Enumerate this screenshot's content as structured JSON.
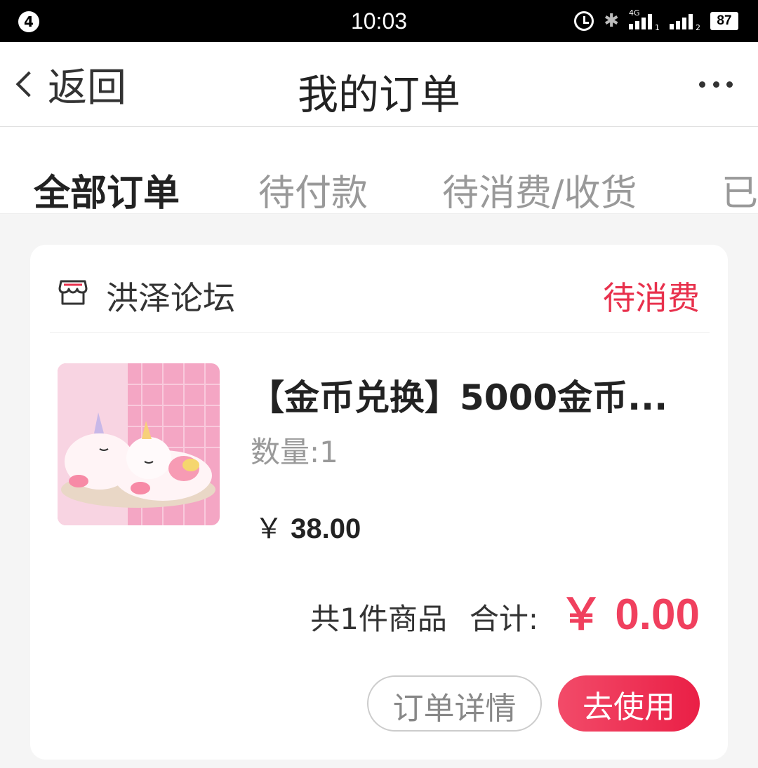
{
  "status_bar": {
    "notification_count": "4",
    "time": "10:03",
    "signal1_label": "4G",
    "signal1_sub": "1",
    "signal2_sub": "2",
    "battery": "87"
  },
  "nav": {
    "back_label": "返回",
    "title": "我的订单"
  },
  "tabs": [
    {
      "label": "全部订单",
      "active": true
    },
    {
      "label": "待付款",
      "active": false
    },
    {
      "label": "待消费/收货",
      "active": false
    },
    {
      "label": "已",
      "active": false
    }
  ],
  "order": {
    "shop_name": "洪泽论坛",
    "status": "待消费",
    "product_title": "【金币兑换】5000金币...",
    "quantity_label": "数量:",
    "quantity": "1",
    "price_currency": "￥",
    "price_value": "38.00",
    "item_count_text": "共1件商品",
    "total_label": "合计:",
    "total_currency": "￥",
    "total_value": "0.00",
    "detail_button": "订单详情",
    "use_button": "去使用"
  },
  "colors": {
    "accent": "#f0405e",
    "status_red": "#e8304c",
    "button_gradient_start": "#f24b69",
    "button_gradient_end": "#ea1f46"
  },
  "icons": [
    "notification-badge",
    "alarm-icon",
    "bluetooth-icon",
    "signal-icon",
    "battery-icon",
    "back-chevron-icon",
    "more-icon",
    "shop-icon"
  ]
}
